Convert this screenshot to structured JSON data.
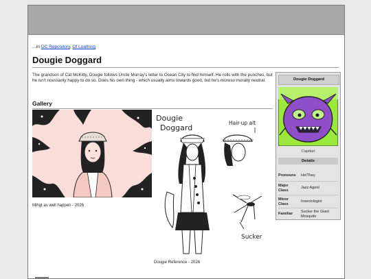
{
  "breadcrumb": {
    "prefix": "...In ",
    "link1": "OC Repository",
    "sep": ", ",
    "link2": "Of Loathing"
  },
  "page": {
    "title": "Dougie Doggard",
    "intro": "The grandson of Cat McKitty, Dougie follows Uncle Murray's letter to Ocean City to find himself. He rolls with the punches, but he isn't ncessarily happy to do so. Does his own thing - which usually aims towards good, but he's moreso morally neutral."
  },
  "gallery": {
    "heading": "Gallery",
    "items": [
      {
        "caption": "Mihgt as well happen - 2026",
        "icon": "portrait-with-tentacles-image"
      },
      {
        "caption": "Dougie Reference - 2026",
        "icon": "character-reference-sheet-image",
        "art_text": {
          "name_line1": "Dougie",
          "name_line2": "Doggard",
          "note": "Hair-up alt",
          "mosquito_label": "Sucker"
        }
      }
    ]
  },
  "infobox": {
    "title": "Dougie Doggard",
    "caption": "Caption",
    "details_heading": "Details",
    "rows": [
      {
        "key": "Pronouns",
        "value": "He/They"
      },
      {
        "key": "Major Class",
        "value": "Jazz Agent"
      },
      {
        "key": "Minor Class",
        "value": "Insectologist"
      },
      {
        "key": "Familiar",
        "value": "Sucker the Giant Mosquito"
      }
    ]
  },
  "colors": {
    "link": "#0a3ec2",
    "topbar": "#a9a9a9",
    "infobox_bg": "#e4e4e4",
    "avatar_bg": "#9be83c",
    "avatar_creature": "#8f4fc8",
    "portrait_bg": "#f9ddd8"
  }
}
